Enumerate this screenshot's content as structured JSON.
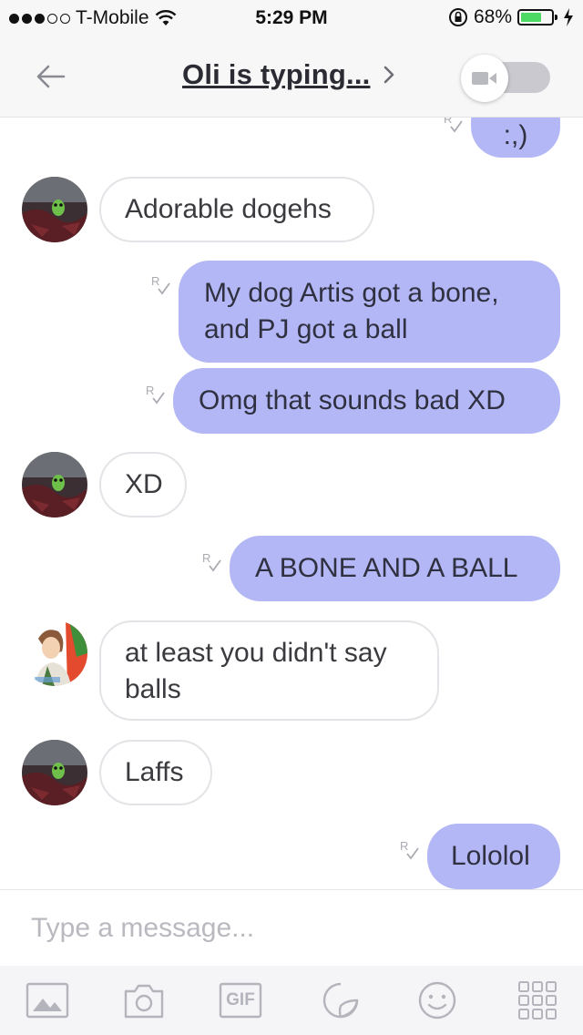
{
  "status_bar": {
    "carrier": "T-Mobile",
    "time": "5:29 PM",
    "battery": "68%",
    "battery_level": 0.68,
    "colors": {
      "battery_fill": "#4cd964"
    }
  },
  "header": {
    "title": "Oli is typing...",
    "chevron": "›"
  },
  "messages": [
    {
      "side": "out",
      "text": ":,)"
    },
    {
      "side": "in",
      "text": "Adorable dogehs"
    },
    {
      "side": "out",
      "text": "My dog Artis got a bone, and PJ got a ball"
    },
    {
      "side": "out",
      "text": "Omg that sounds bad XD"
    },
    {
      "side": "in",
      "text": "XD"
    },
    {
      "side": "out",
      "text": "A BONE AND A BALL"
    },
    {
      "side": "in",
      "text": "at least you didn't say balls"
    },
    {
      "side": "in",
      "text": "Laffs"
    },
    {
      "side": "out",
      "text": "Lololol"
    }
  ],
  "input": {
    "placeholder": "Type a message..."
  },
  "toolbar": {
    "gif_label": "GIF"
  },
  "colors": {
    "outgoing_bubble": "#b3b7f5",
    "incoming_border": "#e4e4e8",
    "icon_gray": "#b4b4bc"
  }
}
